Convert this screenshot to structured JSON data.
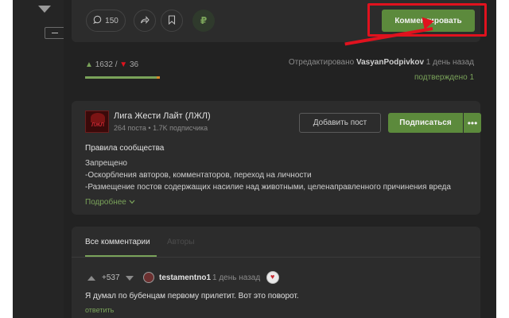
{
  "post_actions": {
    "comments_count": "150",
    "comment_button_label": "Комментировать",
    "comments_icon": "speech-bubble-icon",
    "share_icon": "share-arrow-icon",
    "save_icon": "bookmark-icon",
    "donate_icon": "ruble-icon",
    "donate_glyph": "₽"
  },
  "rating": {
    "upvotes": "1632",
    "separator": "/",
    "downvotes": "36",
    "edited_label": "Отредактировано",
    "editor": "VasyanPodpivkov",
    "edited_time": "1 день назад",
    "confirmed_label": "подтверждено",
    "confirmed_count": "1"
  },
  "community": {
    "name": "Лига Жести Лайт (ЛЖЛ)",
    "stats": "264 поста • 1.7K подписчика",
    "add_post_label": "Добавить пост",
    "subscribe_label": "Подписаться",
    "more_glyph": "•••",
    "rules_title": "Правила сообщества",
    "rules_lines": [
      "Запрещено",
      "-Оскорбления авторов, комментаторов, переход на личности",
      "-Размещение постов содержащих насилие над животными, целенаправленного причинения вреда"
    ],
    "more_link": "Подробнее"
  },
  "comments": {
    "tab_all": "Все комментарии",
    "tab_authors": "Авторы",
    "items": [
      {
        "score": "+537",
        "user": "testamentno1",
        "time": "1 день назад",
        "text": "Я думал по бубенцам первому прилетит. Вот это поворот.",
        "reply_label": "ответить"
      }
    ]
  },
  "colors": {
    "accent_green": "#5c8a3c",
    "annotation_red": "#e0121e",
    "background": "#222222",
    "panel": "#2c2c2c"
  }
}
